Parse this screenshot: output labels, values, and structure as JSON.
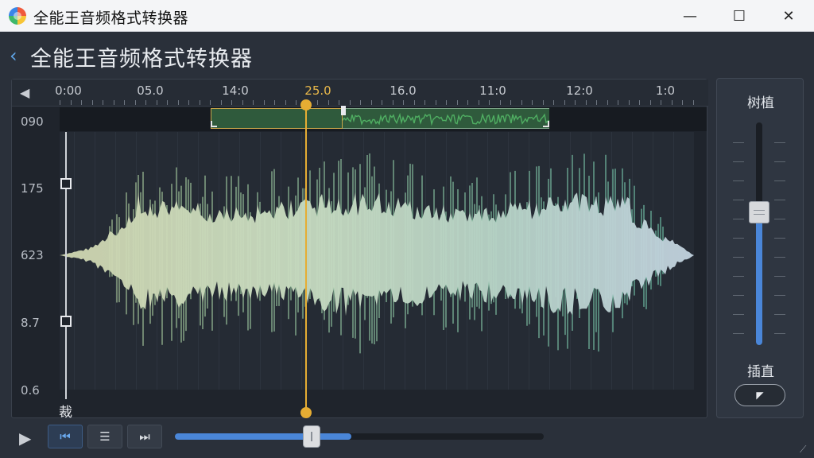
{
  "window": {
    "title": "全能王音频格式转换器",
    "minimize_glyph": "—",
    "maximize_glyph": "☐",
    "close_glyph": "✕"
  },
  "header": {
    "back_glyph": "‹",
    "title": "全能王音频格式转换器"
  },
  "ruler": {
    "arrow_glyph": "◀",
    "labels": [
      "0:00",
      "05.0",
      "14:0",
      "25.0",
      "16.0",
      "11:0",
      "12:0",
      "1:0"
    ],
    "active_label": "25.0"
  },
  "y_axis": {
    "labels": [
      "090",
      "175",
      "623",
      "8.7",
      "0.6"
    ]
  },
  "cut_label": "裁",
  "side_panel": {
    "top_label": "树植",
    "bottom_label": "插直",
    "button_glyph": "◤",
    "slider_level": 0.6
  },
  "bottom_toolbar": {
    "play_glyph": "▶",
    "tool_glyphs": [
      "⏮",
      "☰",
      "⏭"
    ],
    "progress": 0.48
  },
  "colors": {
    "accent": "#4a86d8",
    "playhead": "#e6ad33",
    "selection": "#2f5a3c",
    "waveform_green": "#4fae62"
  },
  "icons": {
    "resize_grip": "⟋"
  }
}
